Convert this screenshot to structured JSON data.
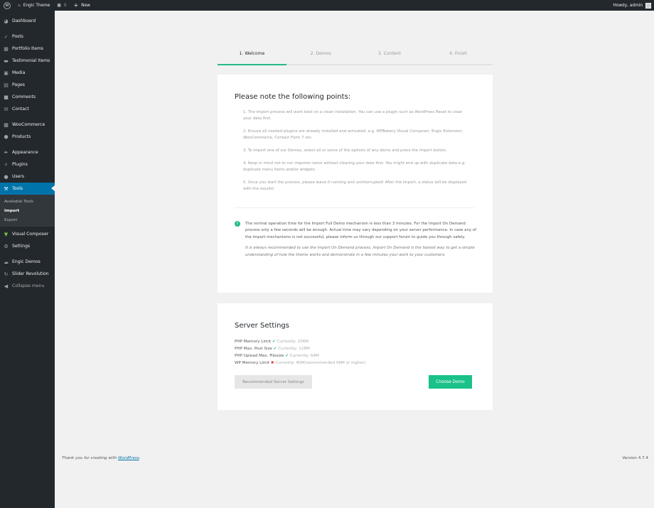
{
  "adminbar": {
    "site_name": "Engic Theme",
    "comments_count": "0",
    "new_label": "New",
    "howdy": "Howdy, admin"
  },
  "sidebar": {
    "items": [
      {
        "label": "Dashboard",
        "icon": "dashboard-icon"
      },
      {
        "label": "Posts",
        "icon": "pin-icon"
      },
      {
        "label": "Portfolio Items",
        "icon": "portfolio-icon"
      },
      {
        "label": "Testimonial Items",
        "icon": "testimonial-icon"
      },
      {
        "label": "Media",
        "icon": "media-icon"
      },
      {
        "label": "Pages",
        "icon": "pages-icon"
      },
      {
        "label": "Comments",
        "icon": "comments-icon"
      },
      {
        "label": "Contact",
        "icon": "mail-icon"
      },
      {
        "label": "WooCommerce",
        "icon": "woocommerce-icon"
      },
      {
        "label": "Products",
        "icon": "products-icon"
      },
      {
        "label": "Appearance",
        "icon": "brush-icon"
      },
      {
        "label": "Plugins",
        "icon": "plugin-icon"
      },
      {
        "label": "Users",
        "icon": "users-icon"
      },
      {
        "label": "Tools",
        "icon": "wrench-icon"
      },
      {
        "label": "Visual Composer",
        "icon": "visual-composer-icon"
      },
      {
        "label": "Settings",
        "icon": "settings-icon"
      },
      {
        "label": "Engic Demos",
        "icon": "engic-icon"
      },
      {
        "label": "Slider Revolution",
        "icon": "refresh-icon"
      },
      {
        "label": "Collapse menu",
        "icon": "collapse-icon"
      }
    ],
    "tools_sub": [
      "Available Tools",
      "Import",
      "Export"
    ]
  },
  "steps": [
    "1. Welcome",
    "2. Demos",
    "3. Content",
    "4. Finish"
  ],
  "notes": {
    "title": "Please note the following points:",
    "points": [
      "1. The import process will work best on a clean installation. You can use a plugin such as WordPress Reset to clear your data first.",
      "2. Ensure all needed plugins are already installed and activated, e.g. WPBakery Visual Composer, Engic Extension, WooCommerce, Contact Form 7 etc.",
      "3. To import one of our Demos, select all or some of the options of any demo and press the import button.",
      "4. Keep in mind not to run importer twice without clearing your data first. You might end up with duplicate data e.g. duplicate menu items and/or widgets.",
      "5. Once you start the process, please leave it running and uninterrupted! After the import, a status will be displayed with the results!"
    ],
    "info": "The normal operation time for the Import Full Demo mechanism is less than 3 minutes. For the Import On Demand process only a few seconds will be enough. Actual time may vary depending on your server performance. In case any of the import mechanisms is not successful, please inform us through our support forum to guide you through safely.",
    "info_italic": "It is always recommended to use the Import On Demand process. Import On Demand is the fastest way to get a simple understanding of how the theme works and demonstrate in a few minutes your work to your customers."
  },
  "server": {
    "title": "Server Settings",
    "rows": [
      {
        "label": "PHP Memory Limit",
        "status": "ok",
        "current": "Currently: 256M"
      },
      {
        "label": "PHP Max. Post Size",
        "status": "ok",
        "current": "Currently: 128M"
      },
      {
        "label": "PHP Upload Max. Filesize",
        "status": "ok",
        "current": "Currently: 64M"
      },
      {
        "label": "WP Memory Limit",
        "status": "bad",
        "current": "Currently: 40M(recommended 96M or higher)"
      }
    ],
    "recommended_button": "Recommended Server Settings",
    "choose_button": "Choose Demo"
  },
  "footer": {
    "thanks_prefix": "Thank you for creating with ",
    "thanks_link": "WordPress",
    "thanks_suffix": ".",
    "version": "Version 4.7.4"
  },
  "colors": {
    "accent": "#27b98c",
    "active_menu": "#0073aa",
    "error": "#dc3232"
  }
}
